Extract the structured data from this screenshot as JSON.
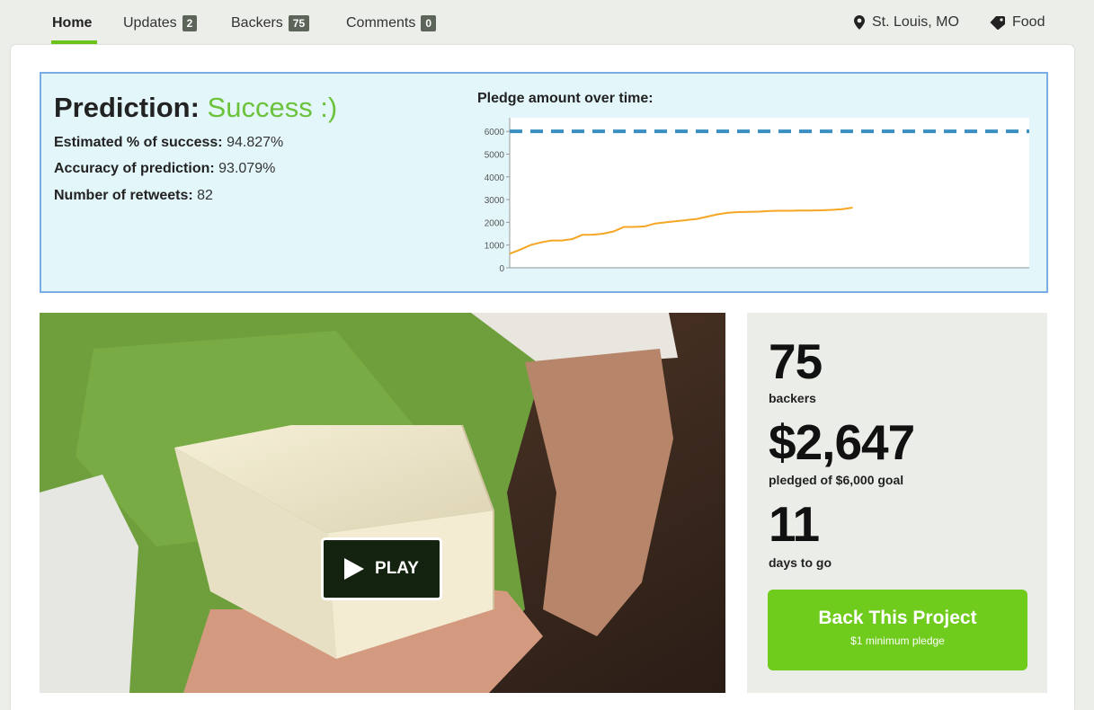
{
  "nav": {
    "tabs": [
      {
        "label": "Home"
      },
      {
        "label": "Updates",
        "count": "2"
      },
      {
        "label": "Backers",
        "count": "75"
      },
      {
        "label": "Comments",
        "count": "0"
      }
    ],
    "location": "St. Louis, MO",
    "category": "Food"
  },
  "prediction": {
    "title_label": "Prediction:",
    "result": "Success :)",
    "stats": [
      {
        "label": "Estimated % of success:",
        "value": "94.827%"
      },
      {
        "label": "Accuracy of prediction:",
        "value": "93.079%"
      },
      {
        "label": "Number of retweets:",
        "value": "82"
      }
    ]
  },
  "chart_data": {
    "type": "line",
    "title": "Pledge amount over time:",
    "ylim": [
      0,
      6600
    ],
    "yticks": [
      "0",
      "1000",
      "2000",
      "3000",
      "4000",
      "5000",
      "6000"
    ],
    "xlim": [
      0,
      1
    ],
    "grid": false,
    "goal_line": 6000,
    "series": [
      {
        "color": "#f5a623",
        "x": [
          0,
          0.02,
          0.04,
          0.06,
          0.08,
          0.1,
          0.12,
          0.14,
          0.16,
          0.18,
          0.2,
          0.22,
          0.24,
          0.26,
          0.28,
          0.3,
          0.32,
          0.34,
          0.36,
          0.38,
          0.4,
          0.42,
          0.44,
          0.46,
          0.48,
          0.5,
          0.52,
          0.54,
          0.56,
          0.58,
          0.6,
          0.62,
          0.64,
          0.66
        ],
        "values": [
          620,
          800,
          1000,
          1120,
          1200,
          1200,
          1260,
          1450,
          1460,
          1500,
          1600,
          1800,
          1800,
          1820,
          1950,
          2000,
          2050,
          2100,
          2150,
          2250,
          2350,
          2420,
          2450,
          2460,
          2470,
          2500,
          2510,
          2510,
          2520,
          2520,
          2530,
          2550,
          2580,
          2647
        ]
      }
    ],
    "goal_color": "#3a8fc0"
  },
  "video": {
    "play_label": "PLAY"
  },
  "stats": {
    "backers_count": "75",
    "backers_label": "backers",
    "pledged": "$2,647",
    "pledged_label": "pledged of $6,000 goal",
    "days": "11",
    "days_label": "days to go"
  },
  "cta": {
    "label": "Back This Project",
    "sub": "$1 minimum pledge"
  }
}
